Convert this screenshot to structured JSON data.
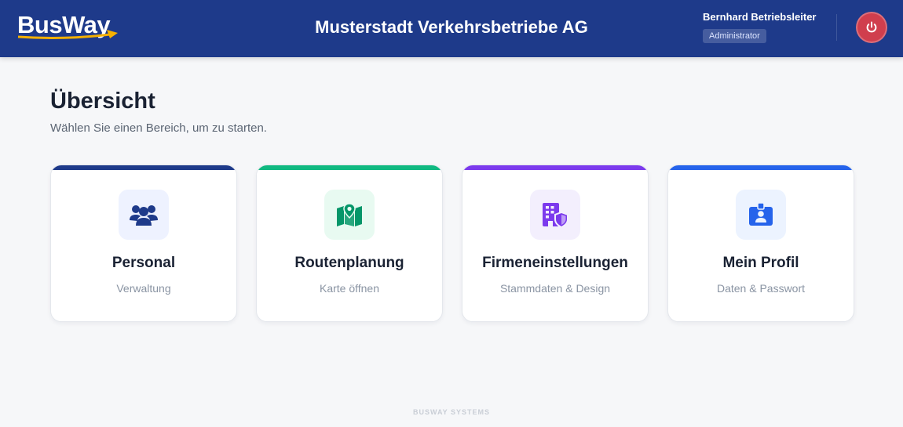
{
  "header": {
    "logo_text": "BusWay",
    "company_name": "Musterstadt Verkehrsbetriebe AG",
    "user_name": "Bernhard Betriebsleiter",
    "user_role": "Administrator"
  },
  "main": {
    "title": "Übersicht",
    "subtitle": "Wählen Sie einen Bereich, um zu starten."
  },
  "cards": [
    {
      "title": "Personal",
      "subtitle": "Verwaltung",
      "icon": "users-icon",
      "accent": "#1e3a8a",
      "icon_color": "#1e3a8a",
      "icon_bg": "#eef2ff"
    },
    {
      "title": "Routenplanung",
      "subtitle": "Karte öffnen",
      "icon": "map-pin-icon",
      "accent": "#10b981",
      "icon_color": "#059669",
      "icon_bg": "#e8faf1"
    },
    {
      "title": "Firmeneinstellungen",
      "subtitle": "Stammdaten & Design",
      "icon": "building-shield-icon",
      "accent": "#7c3aed",
      "icon_color": "#7c3aed",
      "icon_bg": "#f3effd"
    },
    {
      "title": "Mein Profil",
      "subtitle": "Daten & Passwort",
      "icon": "id-badge-icon",
      "accent": "#2563eb",
      "icon_color": "#2563eb",
      "icon_bg": "#ecf3ff"
    }
  ],
  "footer": {
    "text": "BUSWAY SYSTEMS"
  },
  "colors": {
    "header_bg": "#1e3a8a",
    "logout_bg": "#d03e4d",
    "logo_accent": "#f5b000"
  }
}
